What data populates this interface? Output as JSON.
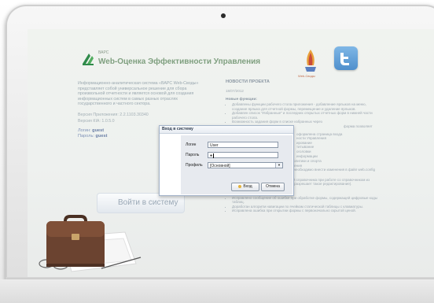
{
  "header": {
    "brand_small": "ВАРС",
    "brand_name": "Web-Оценка Эффективности Управления",
    "ws_caption": "Web-Своды"
  },
  "intro": {
    "description": "Информационно-аналитическая система «ВАРС Web-Своды» представляет собой универсальное решение для сбора произвольной отчетности и является основой для создания информационных систем в самых разных отраслях государственного и частного сектора.",
    "app_version": "Версия Приложения: 2.2.1103.30340",
    "kia_version": "Версия КIA: 1.0.5.0",
    "login_line_label": "Логин:",
    "login_line_value": "guest",
    "password_line_label": "Пароль:",
    "password_line_value": "guest",
    "login_button": "Войти в систему"
  },
  "news": {
    "title": "НОВОСТИ ПРОЕКТА",
    "date": "18/07/2012",
    "section_new": "Новые функции:",
    "new_items": [
      "Добавлены функции рабочего стола приложения - добавление ярлыков на меню, создание ярлыка для отчетной формы, перемещение и удаление ярлыков.",
      "Добавлен список \"Избранные\" и последних открытых отчетных форм в нижней части рабочего стола.",
      "Возможность задания форм в списке избранных через"
    ],
    "mid_lines": [
      "форма позволяет",
      "оформлена страница входа",
      "ности Управления",
      "ирование",
      "титывание",
      "оголовки",
      "информации",
      "Мониторинг молодежной политики и спорта",
      "Мониторинг здравоохранения",
      "Для подключения темы оформления необходимо внести изменения в файл web.config на сервере.",
      "Реализовано редактирование записей справочника при работе со справочником из формы (при условии, что справочник разрешает такое редактирование)."
    ],
    "mid_bold": [
      "Juvenile",
      "Innovative"
    ],
    "section_fixes": "Исправлены ошибки:",
    "fix_items": [
      "Исправлено сообщение об ошибке при обработке формы, содержащей цифровые коды таблиц.",
      "Доработан алгоритм навигации по ячейкам статической таблицы с клавиатуры.",
      "Исправлена ошибка при открытии формы с первоначально скрытой ценой."
    ]
  },
  "dialog": {
    "title": "Вход в систему",
    "login_label": "Логин",
    "login_value": "User",
    "password_label": "Пароль",
    "password_value": "●",
    "profile_label": "Профиль",
    "profile_value": "[Основной]",
    "ok_button": "Вход",
    "cancel_button": "Отмена"
  },
  "colors": {
    "brand_green": "#7f9f7f",
    "twitter_blue": "#4f8fcc",
    "dialog_border": "#a3b3c9"
  },
  "icons": [
    "web-svody-logo-icon",
    "twitter-icon",
    "key-icon",
    "dropdown-arrow-icon",
    "briefcase-icon"
  ]
}
